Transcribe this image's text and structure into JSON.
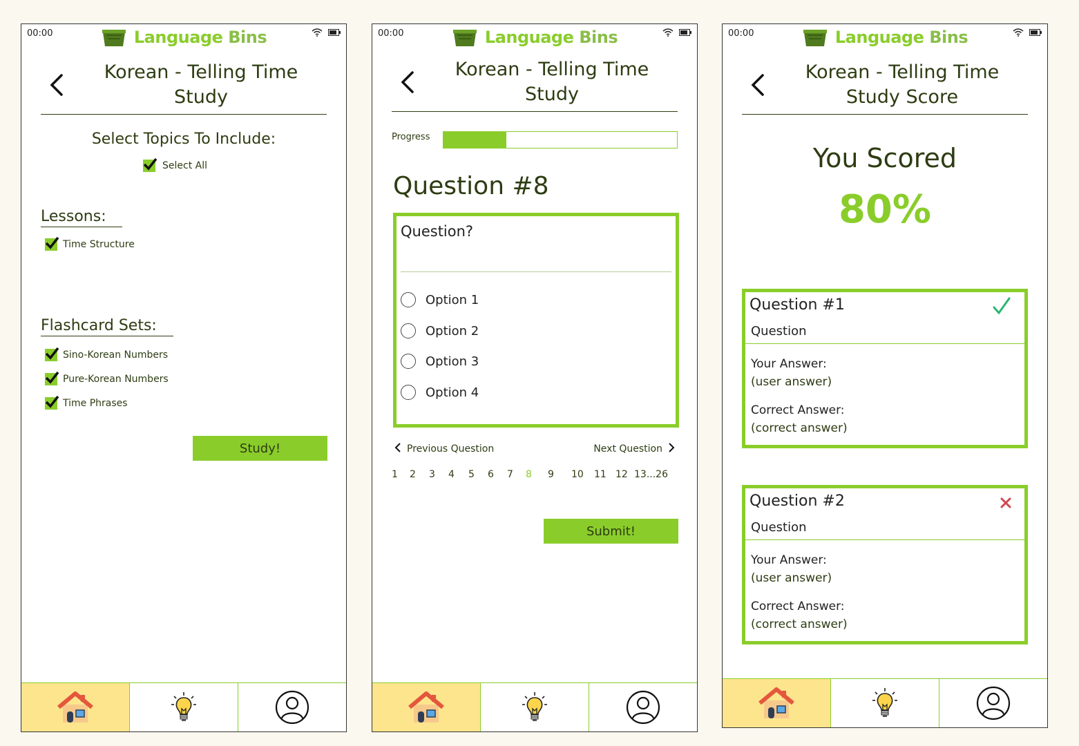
{
  "screens": {
    "study_setup": {
      "status_time": "00:00",
      "app_name_part1": "Language",
      "app_name_part2": "Bins",
      "title_line1": "Korean - Telling Time",
      "title_line2": "Study",
      "select_heading": "Select Topics To Include:",
      "select_all": "Select All",
      "lessons_label": "Lessons:",
      "lessons": [
        "Time Structure"
      ],
      "flashcard_label": "Flashcard Sets:",
      "flashcard_sets": [
        "Sino-Korean Numbers",
        "Pure-Korean Numbers",
        "Time Phrases"
      ],
      "study_button": "Study!"
    },
    "quiz": {
      "status_time": "00:00",
      "app_name_part1": "Language",
      "app_name_part2": "Bins",
      "title_line1": "Korean - Telling Time",
      "title_line2": "Study",
      "progress_label": "Progress",
      "progress_fraction": 0.27,
      "question_heading": "Question #8",
      "question_text": "Question?",
      "options": [
        "Option 1",
        "Option 2",
        "Option 3",
        "Option 4"
      ],
      "previous": "Previous Question",
      "next": "Next Question",
      "pages": [
        "1",
        "2",
        "3",
        "4",
        "5",
        "6",
        "7",
        "8",
        "9",
        "10",
        "11",
        "12",
        "13...26"
      ],
      "current_page": "8",
      "submit_button": "Submit!"
    },
    "score": {
      "status_time": "00:00",
      "app_name_part1": "Language",
      "app_name_part2": "Bins",
      "title_line1": "Korean - Telling Time",
      "title_line2": "Study Score",
      "you_scored": "You Scored",
      "score": "80%",
      "results": [
        {
          "title": "Question #1",
          "question": "Question",
          "your_answer_label": "Your Answer:",
          "your_answer": "(user answer)",
          "correct_label": "Correct Answer:",
          "correct_answer": "(correct answer)",
          "status": "correct"
        },
        {
          "title": "Question #2",
          "question": "Question",
          "your_answer_label": "Your Answer:",
          "your_answer": "(user answer)",
          "correct_label": "Correct Answer:",
          "correct_answer": "(correct answer)",
          "status": "incorrect"
        }
      ]
    }
  },
  "tabbar": {
    "icons": [
      "home-icon",
      "lightbulb-icon",
      "profile-icon"
    ]
  },
  "colors": {
    "accent": "#8acd2b",
    "text": "#2d3c12",
    "home_tab_bg": "#fde58d",
    "correct": "#2bb673",
    "incorrect": "#d0464f"
  }
}
